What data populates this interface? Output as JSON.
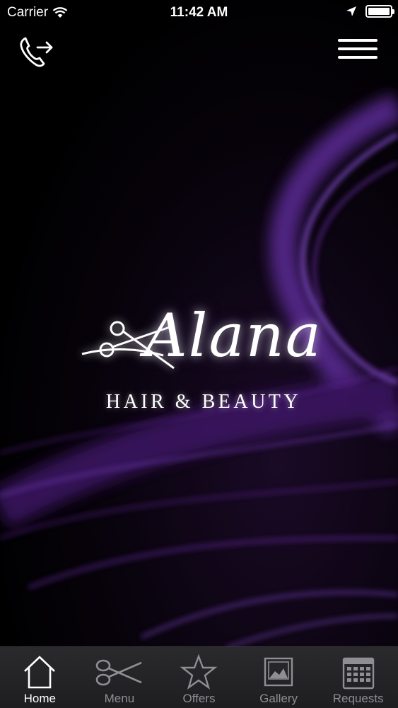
{
  "status_bar": {
    "carrier": "Carrier",
    "time": "11:42 AM",
    "icons": [
      "wifi-icon",
      "location-arrow-icon",
      "battery-icon"
    ],
    "battery_level": 1.0
  },
  "header": {
    "call_icon": "phone-forward-icon",
    "menu_icon": "hamburger-icon"
  },
  "logo": {
    "name": "Alana",
    "tagline": "HAIR & BEAUTY",
    "icon": "scissors-icon"
  },
  "tab_bar": {
    "tabs": [
      {
        "label": "Home",
        "icon": "home-icon",
        "active": true
      },
      {
        "label": "Menu",
        "icon": "scissors-icon",
        "active": false
      },
      {
        "label": "Offers",
        "icon": "star-icon",
        "active": false
      },
      {
        "label": "Gallery",
        "icon": "picture-icon",
        "active": false
      },
      {
        "label": "Requests",
        "icon": "calendar-icon",
        "active": false
      }
    ]
  },
  "colors": {
    "background": "#000000",
    "accent_purple": "#6a2fa8",
    "tab_bar": "#222224",
    "tab_inactive": "#8e8e93",
    "tab_active": "#ffffff"
  }
}
